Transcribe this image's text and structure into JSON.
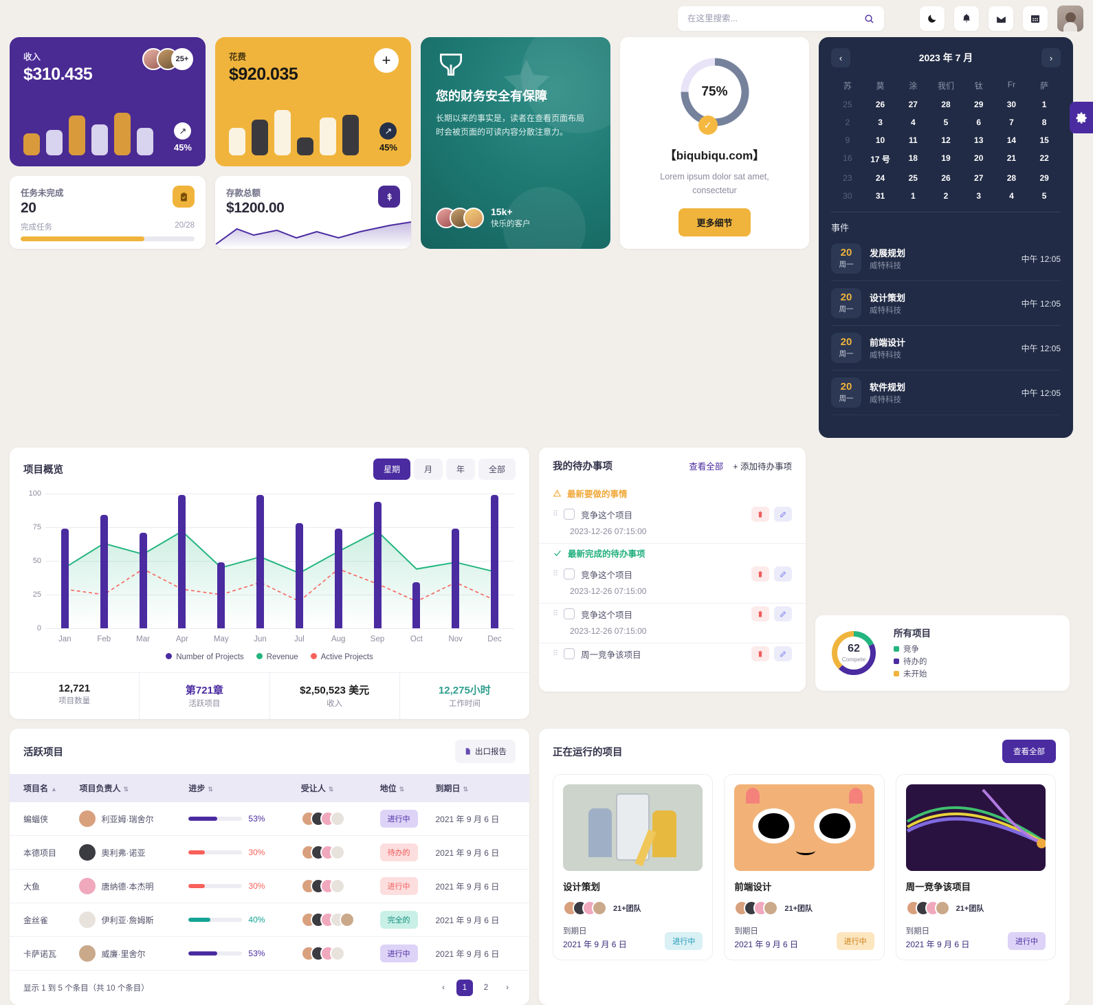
{
  "header": {
    "search_placeholder": "在这里搜索...",
    "search_value": "",
    "icons": [
      {
        "name": "moon-icon",
        "glyph": "☽"
      },
      {
        "name": "bell-icon",
        "glyph": "🔔"
      },
      {
        "name": "mail-icon",
        "glyph": "✉"
      },
      {
        "name": "calendar-icon",
        "glyph": "📅"
      }
    ],
    "settings_tab": "gear-icon"
  },
  "revenue_card": {
    "label": "收入",
    "value": "$310.435",
    "avatars_more": "25+",
    "pct": "45%",
    "trend_icon": "arrow-up-right-icon",
    "bars": [
      44,
      52,
      80,
      62,
      86,
      56
    ],
    "bar_colors": [
      "#d99a3c",
      "#d8d3ee",
      "#d99a3c",
      "#d8d3ee",
      "#d99a3c",
      "#d8d3ee"
    ]
  },
  "expense_card": {
    "label": "花费",
    "value": "$920.035",
    "pct": "45%",
    "add_icon": "plus-icon",
    "trend_icon": "arrow-up-right-icon",
    "bars": [
      55,
      72,
      92,
      36,
      76,
      82
    ],
    "bar_colors": [
      "#fbf3e2",
      "#3a3a3e",
      "#fbf3e2",
      "#3a3a3e",
      "#fbf3e2",
      "#3a3a3e"
    ]
  },
  "tasks_card": {
    "title": "任务未完成",
    "value": "20",
    "sub_label": "完成任务",
    "sub_value": "20/28",
    "progress_pct": 71,
    "icon": "clipboard-check-icon"
  },
  "deposit_card": {
    "title": "存款总额",
    "value": "$1200.00",
    "icon": "dollar-icon"
  },
  "promo_card": {
    "logo": "shield-leaf-icon",
    "title": "您的财务安全有保障",
    "body": "长期以来的事实是，读者在查看页面布局时会被页面的可读内容分散注意力。",
    "count": "15k+",
    "count_label": "快乐的客户"
  },
  "gauge_card": {
    "percent": "75%",
    "percent_value": 75,
    "check_icon": "check-circle-icon",
    "title": "【biqubiqu.com】",
    "subtitle": "Lorem ipsum dolor sat amet, consectetur",
    "button": "更多细节",
    "ring_color": "#76829c",
    "track_color": "#e8e3f6",
    "accent": "#f5b942"
  },
  "calendar": {
    "prev_icon": "chevron-left-icon",
    "next_icon": "chevron-right-icon",
    "title": "2023 年 7 月",
    "dow": [
      "苏",
      "莫",
      "涂",
      "我们",
      "钛",
      "Fr",
      "萨"
    ],
    "weeks": [
      [
        {
          "d": "25",
          "m": true
        },
        {
          "d": "26"
        },
        {
          "d": "27"
        },
        {
          "d": "28"
        },
        {
          "d": "29"
        },
        {
          "d": "30"
        },
        {
          "d": "1"
        }
      ],
      [
        {
          "d": "2",
          "m": true
        },
        {
          "d": "3"
        },
        {
          "d": "4"
        },
        {
          "d": "5"
        },
        {
          "d": "6"
        },
        {
          "d": "7"
        },
        {
          "d": "8"
        }
      ],
      [
        {
          "d": "9",
          "m": true
        },
        {
          "d": "10"
        },
        {
          "d": "11"
        },
        {
          "d": "12"
        },
        {
          "d": "13"
        },
        {
          "d": "14"
        },
        {
          "d": "15"
        }
      ],
      [
        {
          "d": "16",
          "m": true
        },
        {
          "d": "17 号"
        },
        {
          "d": "18"
        },
        {
          "d": "19"
        },
        {
          "d": "20"
        },
        {
          "d": "21",
          "sel": true
        },
        {
          "d": "22"
        }
      ],
      [
        {
          "d": "23",
          "m": true
        },
        {
          "d": "24"
        },
        {
          "d": "25"
        },
        {
          "d": "26"
        },
        {
          "d": "27"
        },
        {
          "d": "28"
        },
        {
          "d": "29"
        }
      ],
      [
        {
          "d": "30",
          "m": true
        },
        {
          "d": "31"
        },
        {
          "d": "1"
        },
        {
          "d": "2"
        },
        {
          "d": "3"
        },
        {
          "d": "4"
        },
        {
          "d": "5"
        }
      ]
    ],
    "events_title": "事件",
    "events": [
      {
        "day": "20",
        "dow": "周一",
        "title": "发展规划",
        "org": "威特科技",
        "time": "中午 12:05"
      },
      {
        "day": "20",
        "dow": "周一",
        "title": "设计策划",
        "org": "威特科技",
        "time": "中午 12:05"
      },
      {
        "day": "20",
        "dow": "周一",
        "title": "前端设计",
        "org": "威特科技",
        "time": "中午 12:05"
      },
      {
        "day": "20",
        "dow": "周一",
        "title": "软件规划",
        "org": "威特科技",
        "time": "中午 12:05"
      }
    ]
  },
  "overview": {
    "title": "项目概览",
    "segments": [
      {
        "label": "星期",
        "active": true
      },
      {
        "label": "月",
        "active": false
      },
      {
        "label": "年",
        "active": false
      },
      {
        "label": "全部",
        "active": false
      }
    ],
    "stats": [
      {
        "value": "12,721",
        "label": "项目数量",
        "color": "#1c1c1c"
      },
      {
        "value": "第721章",
        "label": "活跃项目",
        "color": "#4a2ba0"
      },
      {
        "value": "$2,50,523 美元",
        "label": "收入",
        "color": "#1c1c1c"
      },
      {
        "value": "12,275小时",
        "label": "工作时间",
        "color": "#2f9e8d"
      }
    ]
  },
  "chart_data": {
    "type": "bar",
    "title": "项目概览",
    "categories": [
      "Jan",
      "Feb",
      "Mar",
      "Apr",
      "May",
      "Jun",
      "Jul",
      "Aug",
      "Sep",
      "Oct",
      "Nov",
      "Dec"
    ],
    "series": [
      {
        "name": "Number of Projects",
        "type": "bar",
        "color": "#4a2ba0",
        "values": [
          74,
          84,
          71,
          99,
          49,
          99,
          78,
          74,
          94,
          34,
          74,
          99
        ]
      },
      {
        "name": "Revenue",
        "type": "area",
        "color": "#23b57e",
        "values": [
          45,
          63,
          55,
          72,
          45,
          53,
          41,
          57,
          72,
          44,
          49,
          42
        ]
      },
      {
        "name": "Active Projects",
        "type": "line-dashed",
        "color": "#f8615a",
        "values": [
          29,
          25,
          44,
          29,
          25,
          34,
          20,
          44,
          33,
          20,
          34,
          21
        ]
      }
    ],
    "xlabel": "",
    "ylabel": "",
    "ylim": [
      0,
      100
    ],
    "yticks": [
      0,
      25,
      50,
      75,
      100
    ],
    "grid": true,
    "legend": "bottom"
  },
  "todo": {
    "title": "我的待办事项",
    "view_all": "查看全部",
    "add": "+ 添加待办事项",
    "flag_new": "最新要做的事情",
    "flag_done": "最新完成的待办事项",
    "warn_icon": "warning-triangle-icon",
    "check_icon": "check-icon",
    "items": [
      {
        "text": "竞争这个项目",
        "time": "2023-12-26 07:15:00",
        "group": "new"
      },
      {
        "text": "竞争这个项目",
        "time": "2023-12-26 07:15:00",
        "group": "done"
      },
      {
        "text": "竞争这个项目",
        "time": "2023-12-26 07:15:00",
        "group": "none"
      },
      {
        "text": "周一竞争该项目",
        "time": "",
        "group": "none"
      }
    ],
    "delete_icon": "trash-icon",
    "edit_icon": "pencil-icon"
  },
  "all_projects": {
    "center_value": "62",
    "center_label": "Compete",
    "title": "所有项目",
    "legend": [
      {
        "label": "竞争",
        "color": "#23b57e",
        "value": 18
      },
      {
        "label": "待办的",
        "color": "#4a2ba0",
        "value": 44
      },
      {
        "label": "未开始",
        "color": "#f0b43c",
        "value": 38
      }
    ]
  },
  "active_projects": {
    "title": "活跃项目",
    "export_button": "出口报告",
    "export_icon": "file-export-icon",
    "columns": [
      {
        "label": "项目名",
        "sort": "asc"
      },
      {
        "label": "项目负责人",
        "sort": "both"
      },
      {
        "label": "进步",
        "sort": "both"
      },
      {
        "label": "受让人",
        "sort": "both"
      },
      {
        "label": "地位",
        "sort": "both"
      },
      {
        "label": "到期日",
        "sort": "both"
      }
    ],
    "rows": [
      {
        "name": "蝙蝠侠",
        "owner": "利亚姆·瑞舍尔",
        "owner_color": "#d9a07e",
        "pct": "53%",
        "pct_val": 53,
        "bar": "#4a2ba0",
        "team": 4,
        "status": "进行中",
        "status_bg": "#ddd3f7",
        "status_fg": "#4a2ba0",
        "due": "2021 年 9 月 6 日"
      },
      {
        "name": "本德项目",
        "owner": "奥利弗·诺亚",
        "owner_color": "#3b3b42",
        "pct": "30%",
        "pct_val": 30,
        "bar": "#f8615a",
        "team": 4,
        "status": "待办的",
        "status_bg": "#fcdede",
        "status_fg": "#f05b5b",
        "due": "2021 年 9 月 6 日"
      },
      {
        "name": "大鱼",
        "owner": "唐纳德·本杰明",
        "owner_color": "#f0a8bd",
        "pct": "30%",
        "pct_val": 30,
        "bar": "#f8615a",
        "team": 4,
        "status": "进行中",
        "status_bg": "#fcdede",
        "status_fg": "#f05b5b",
        "due": "2021 年 9 月 6 日"
      },
      {
        "name": "金丝雀",
        "owner": "伊利亚·詹姆斯",
        "owner_color": "#e8e2dc",
        "pct": "40%",
        "pct_val": 40,
        "bar": "#14a394",
        "team": 5,
        "status": "完全的",
        "status_bg": "#c9f0e6",
        "status_fg": "#0f8d7e",
        "due": "2021 年 9 月 6 日"
      },
      {
        "name": "卡萨诺瓦",
        "owner": "威廉·里舍尔",
        "owner_color": "#caa98b",
        "pct": "53%",
        "pct_val": 53,
        "bar": "#4a2ba0",
        "team": 4,
        "status": "进行中",
        "status_bg": "#ddd3f7",
        "status_fg": "#4a2ba0",
        "due": "2021 年 9 月 6 日"
      }
    ],
    "footer_text": "显示 1 到 5 个条目（共 10 个条目）",
    "prev_icon": "chevron-left-icon",
    "next_icon": "chevron-right-icon",
    "pages": [
      "1",
      "2"
    ],
    "current_page": "1"
  },
  "running_projects": {
    "title": "正在运行的项目",
    "view_all": "查看全部",
    "cards": [
      {
        "title": "设计策划",
        "team": "21+团队",
        "due_label": "到期日",
        "due": "2021 年 9 月 6 日",
        "status": "进行中",
        "status_bg": "#d9f0f5",
        "status_fg": "#1f9ab5",
        "thumb": "illustration-mobile-design"
      },
      {
        "title": "前端设计",
        "team": "21+团队",
        "due_label": "到期日",
        "due": "2021 年 9 月 6 日",
        "status": "进行中",
        "status_bg": "#fce6c0",
        "status_fg": "#c97c12",
        "thumb": "illustration-cartoon-face"
      },
      {
        "title": "周一竞争该项目",
        "team": "21+团队",
        "due_label": "到期日",
        "due": "2021 年 9 月 6 日",
        "status": "进行中",
        "status_bg": "#ddd3f7",
        "status_fg": "#4a2ba0",
        "thumb": "illustration-dark-curves"
      }
    ]
  }
}
